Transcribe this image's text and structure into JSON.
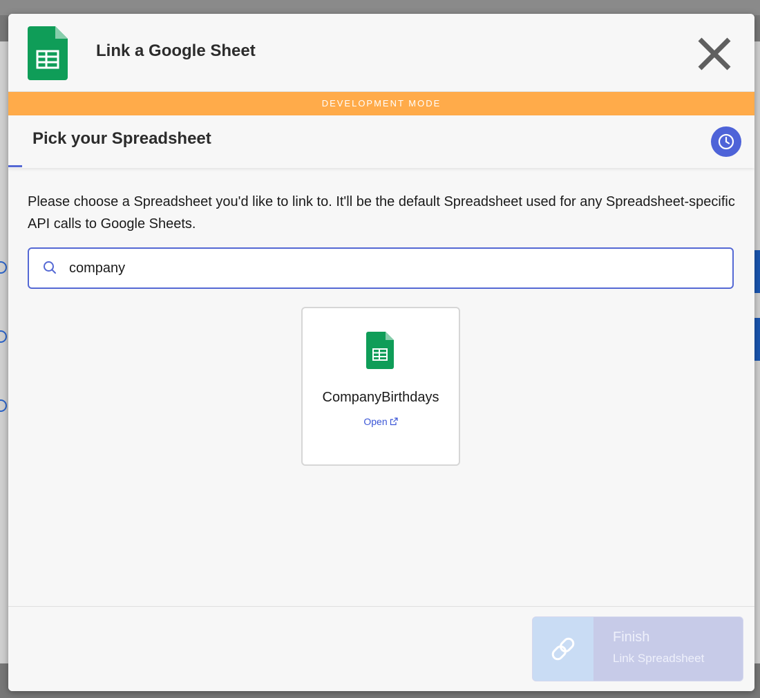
{
  "modal": {
    "title": "Link a Google Sheet",
    "dev_banner": "DEVELOPMENT MODE",
    "step_title": "Pick your Spreadsheet",
    "description": "Please choose a Spreadsheet you'd like to link to. It'll be the default Spreadsheet used for any Spreadsheet-specific API calls to Google Sheets.",
    "search": {
      "value": "company"
    },
    "results": [
      {
        "name": "CompanyBirthdays",
        "open_label": "Open"
      }
    ],
    "finish": {
      "label": "Finish",
      "sublabel": "Link Spreadsheet"
    }
  },
  "colors": {
    "accent": "#5468d4",
    "dev_banner": "#ffab4a",
    "sheets_green": "#0f9d58"
  },
  "icons": {
    "app": "google-sheets-icon",
    "close": "close-icon",
    "history": "clock-icon",
    "search": "search-icon",
    "open": "external-link-icon",
    "finish": "link-icon"
  }
}
